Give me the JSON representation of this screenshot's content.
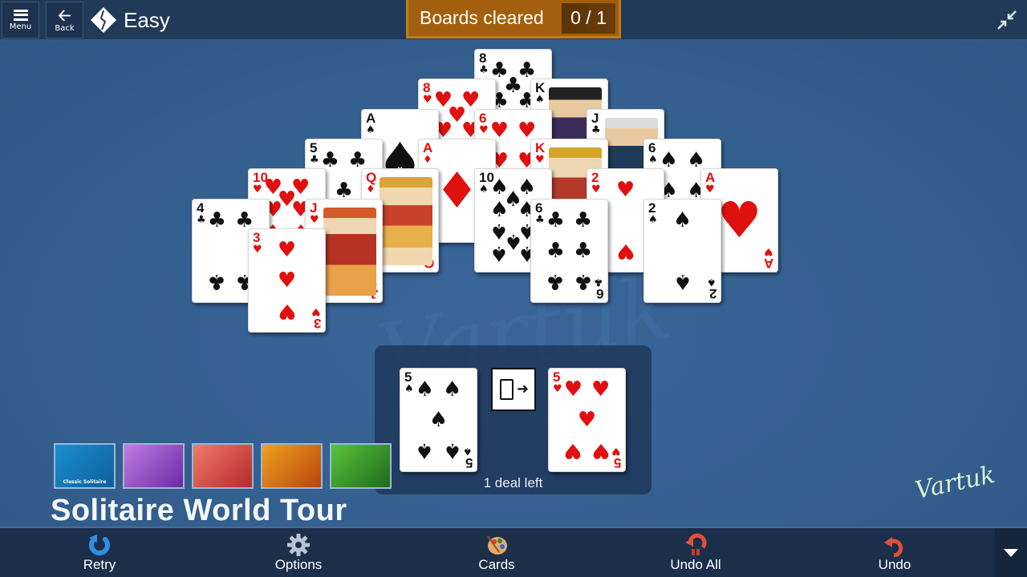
{
  "topbar": {
    "menu_label": "Menu",
    "back_label": "Back",
    "difficulty": "Easy",
    "score_label": "Boards cleared",
    "score_value": "0 / 1"
  },
  "pyramid": {
    "rows": [
      [
        {
          "rank": "8",
          "suit": "clubs"
        }
      ],
      [
        {
          "rank": "8",
          "suit": "hearts"
        },
        {
          "rank": "K",
          "suit": "spades"
        }
      ],
      [
        {
          "rank": "A",
          "suit": "spades"
        },
        {
          "rank": "6",
          "suit": "hearts"
        },
        {
          "rank": "J",
          "suit": "clubs"
        }
      ],
      [
        {
          "rank": "5",
          "suit": "clubs"
        },
        {
          "rank": "A",
          "suit": "diamonds"
        },
        {
          "rank": "K",
          "suit": "hearts"
        },
        {
          "rank": "6",
          "suit": "spades"
        }
      ],
      [
        {
          "rank": "10",
          "suit": "hearts"
        },
        {
          "rank": "Q",
          "suit": "diamonds"
        },
        {
          "rank": "10",
          "suit": "spades"
        },
        {
          "rank": "2",
          "suit": "hearts"
        },
        {
          "rank": "A",
          "suit": "hearts"
        }
      ],
      [
        {
          "rank": "4",
          "suit": "clubs"
        },
        {
          "rank": "J",
          "suit": "hearts"
        },
        {
          "rank": "6",
          "suit": "clubs"
        },
        {
          "rank": "2",
          "suit": "spades"
        }
      ],
      [
        {
          "rank": "3",
          "suit": "hearts"
        }
      ]
    ]
  },
  "stock": {
    "stock_card": {
      "rank": "5",
      "suit": "spades"
    },
    "waste_card": {
      "rank": "5",
      "suit": "hearts"
    },
    "deal_icon": "deal-card-arrow-icon",
    "deals_left_text": "1 deal left"
  },
  "promo": {
    "thumbnails": [
      {
        "name": "classic-solitaire",
        "caption": "Classic Solitaire",
        "colors": [
          "#1a8fd0",
          "#0e5f9a"
        ]
      },
      {
        "name": "purple-swirl",
        "caption": "",
        "colors": [
          "#c27be0",
          "#6a2aa6"
        ]
      },
      {
        "name": "red-scene",
        "caption": "",
        "colors": [
          "#f07a6a",
          "#b52a2a"
        ]
      },
      {
        "name": "pyramid",
        "caption": "",
        "colors": [
          "#f0a020",
          "#b8440a"
        ]
      },
      {
        "name": "green-mountains",
        "caption": "",
        "colors": [
          "#58c43a",
          "#1f6a1a"
        ]
      }
    ],
    "title": "Solitaire World Tour"
  },
  "signature_text": "Vartuk",
  "bottombar": {
    "buttons": [
      {
        "label": "Retry",
        "icon": "retry-icon"
      },
      {
        "label": "Options",
        "icon": "gear-icon"
      },
      {
        "label": "Cards",
        "icon": "palette-icon"
      },
      {
        "label": "Undo All",
        "icon": "undo-all-icon"
      },
      {
        "label": "Undo",
        "icon": "undo-icon"
      }
    ]
  },
  "colors": {
    "board": "#355d8c",
    "topbar": "#223a59",
    "score_box": "#a35f0d",
    "red_suit": "#e01010",
    "black_suit": "#111111"
  }
}
